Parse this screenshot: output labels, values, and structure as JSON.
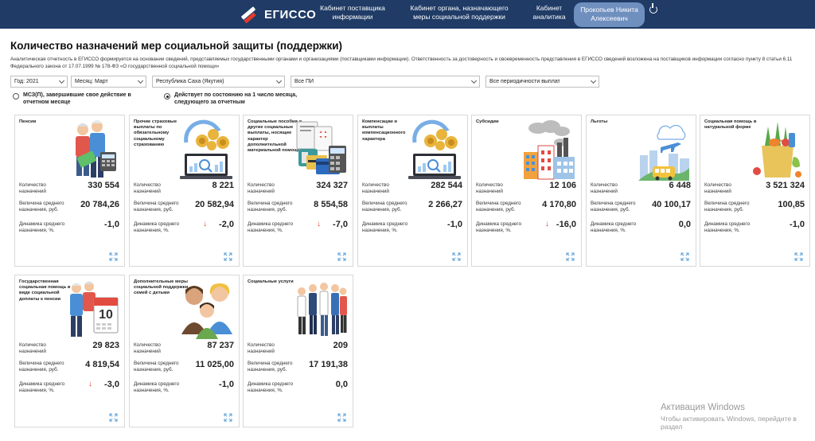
{
  "header": {
    "logo": "ЕГИССО",
    "nav": [
      {
        "label": "Кабинет поставщика информации"
      },
      {
        "label": "Кабинет органа, назначающего меры социальной поддержки"
      },
      {
        "label": "Кабинет аналитика"
      }
    ],
    "user": "Прокопьев Никита Алексеевич"
  },
  "page": {
    "title": "Количество назначений мер социальной защиты (поддержки)",
    "disclaimer": "Аналитическая отчетность в ЕГИССО формируется на основании сведений, представляемых государственными органами и организациями (поставщиками информации). Ответственность за достоверность и своевременность представления в ЕГИССО сведений возложена на поставщиков информации согласно пункту 8 статьи 6.11 Федерального закона от 17.07.1999 № 178-ФЗ «О государственной социальной помощи»"
  },
  "filters": {
    "year": "Год: 2021",
    "month": "Месяц: Март",
    "region": "Республика Саха (Якутия)",
    "provider": "Все ПИ",
    "periodicity": "Все периодичности выплат"
  },
  "radios": {
    "option1": "МСЗ(П), завершившие свое действие в отчетном месяце",
    "option2": "Действует по состоянию на 1 число месяца, следующего за отчетным",
    "selected": "option2"
  },
  "labels": {
    "count": "Количество назначений",
    "avg": "Величина среднего назначения, руб.",
    "dyn": "Динамика среднего назначения, %."
  },
  "cards": [
    {
      "title": "Пенсии",
      "count": "330 554",
      "avg": "20 784,26",
      "dyn": "-1,0",
      "down": false,
      "icon": "pension-icon"
    },
    {
      "title": "Прочие страховые выплаты по обязательному социальному страхованию",
      "count": "8 221",
      "avg": "20 582,94",
      "dyn": "-2,0",
      "down": true,
      "icon": "laptop-coins-icon"
    },
    {
      "title": "Социальные пособия и другие социальные выплаты, носящие характер дополнительной материальной помощи",
      "count": "324 327",
      "avg": "8 554,58",
      "dyn": "-7,0",
      "down": true,
      "icon": "documents-card-icon"
    },
    {
      "title": "Компенсации и выплаты компенсационного характера",
      "count": "282 544",
      "avg": "2 266,27",
      "dyn": "-1,0",
      "down": false,
      "icon": "laptop-coins-icon"
    },
    {
      "title": "Субсидии",
      "count": "12 106",
      "avg": "4 170,80",
      "dyn": "-16,0",
      "down": true,
      "icon": "buildings-icon"
    },
    {
      "title": "Льготы",
      "count": "6 448",
      "avg": "40 100,17",
      "dyn": "0,0",
      "down": false,
      "icon": "city-transport-icon"
    },
    {
      "title": "Социальная помощь в натуральной форме",
      "count": "3 521 324",
      "avg": "100,85",
      "dyn": "-1,0",
      "down": false,
      "icon": "groceries-icon"
    },
    {
      "title": "Государственная социальная помощь в виде социальной доплаты к пенсии",
      "count": "29 823",
      "avg": "4 819,54",
      "dyn": "-3,0",
      "down": true,
      "icon": "calendar-elderly-icon"
    },
    {
      "title": "Дополнительные меры социальной поддержки семей с детьми",
      "count": "87 237",
      "avg": "11 025,00",
      "dyn": "-1,0",
      "down": false,
      "icon": "family-icon"
    },
    {
      "title": "Социальные услуги",
      "count": "209",
      "avg": "17 191,38",
      "dyn": "0,0",
      "down": false,
      "icon": "professionals-icon"
    }
  ],
  "watermark": {
    "line1": "Активация Windows",
    "line2": "Чтобы активировать Windows, перейдите в раздел"
  }
}
